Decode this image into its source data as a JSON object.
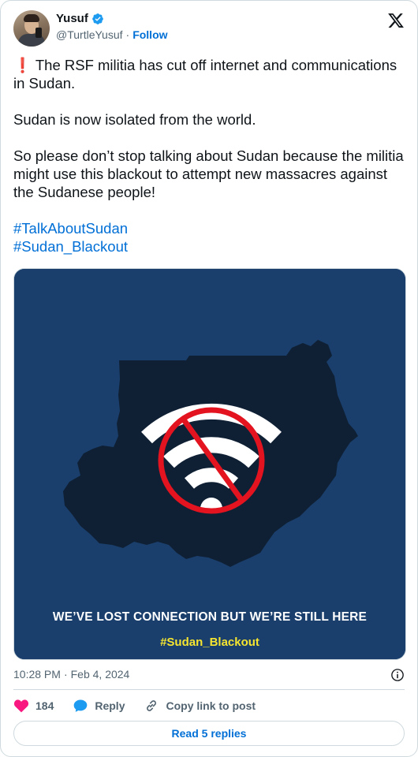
{
  "author": {
    "display_name": "Yusuf",
    "handle": "@TurtleYusuf",
    "separator": "·",
    "follow_label": "Follow"
  },
  "tweet": {
    "line1_emoji": "❗",
    "line1": " The RSF militia has cut off internet and communications in Sudan.",
    "line2": "Sudan is now isolated from the world.",
    "line3": "So please don’t stop talking about Sudan because the militia might use this blackout to attempt new massacres against the Sudanese people!",
    "hashtags": [
      "#TalkAboutSudan",
      "#Sudan_Blackout"
    ]
  },
  "media": {
    "caption": "WE’VE LOST CONNECTION BUT WE’RE STILL HERE",
    "caption_tag": "#Sudan_Blackout",
    "colors": {
      "background": "#1a3f6c",
      "map": "#0f2035",
      "ban": "#e3141f",
      "wifi": "#ffffff",
      "tag": "#f5e530"
    }
  },
  "meta": {
    "time": "10:28 PM",
    "separator": "·",
    "date": "Feb 4, 2024"
  },
  "actions": {
    "like_count": "184",
    "reply_label": "Reply",
    "copy_label": "Copy link to post"
  },
  "read_replies_label": "Read 5 replies",
  "icons": [
    "verified-badge-icon",
    "x-logo-icon",
    "info-icon",
    "heart-icon",
    "reply-bubble-icon",
    "link-icon"
  ]
}
